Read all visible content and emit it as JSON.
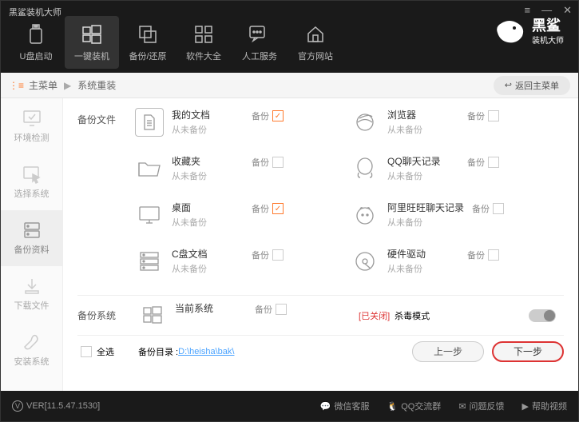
{
  "window": {
    "title": "黑鲨装机大师"
  },
  "nav": {
    "usb": "U盘启动",
    "onekey": "一键装机",
    "backup": "备份/还原",
    "software": "软件大全",
    "service": "人工服务",
    "website": "官方网站"
  },
  "logo": {
    "name": "黑鲨",
    "sub": "装机大师"
  },
  "crumb": {
    "main": "主菜单",
    "sub": "系统重装",
    "back": "返回主菜单"
  },
  "side": {
    "env": "环境检测",
    "select": "选择系统",
    "data": "备份资料",
    "download": "下载文件",
    "install": "安装系统"
  },
  "section": {
    "files": "备份文件",
    "system": "备份系统"
  },
  "items": {
    "docs": {
      "name": "我的文档",
      "sub": "从未备份"
    },
    "fav": {
      "name": "收藏夹",
      "sub": "从未备份"
    },
    "desktop": {
      "name": "桌面",
      "sub": "从未备份"
    },
    "cdisk": {
      "name": "C盘文档",
      "sub": "从未备份"
    },
    "browser": {
      "name": "浏览器",
      "sub": "从未备份"
    },
    "qq": {
      "name": "QQ聊天记录",
      "sub": "从未备份"
    },
    "ww": {
      "name": "阿里旺旺聊天记录",
      "sub": "从未备份"
    },
    "hw": {
      "name": "硬件驱动",
      "sub": "从未备份"
    },
    "cursys": {
      "name": "当前系统"
    }
  },
  "labels": {
    "backup": "备份",
    "selectall": "全选",
    "dir": "备份目录 :",
    "path": "D:\\heisha\\bak\\",
    "prev": "上一步",
    "next": "下一步"
  },
  "kill": {
    "status": "[已关闭]",
    "label": "杀毒模式"
  },
  "footer": {
    "ver": "VER[11.5.47.1530]",
    "wx": "微信客服",
    "qq": "QQ交流群",
    "fb": "问题反馈",
    "help": "帮助视频"
  }
}
